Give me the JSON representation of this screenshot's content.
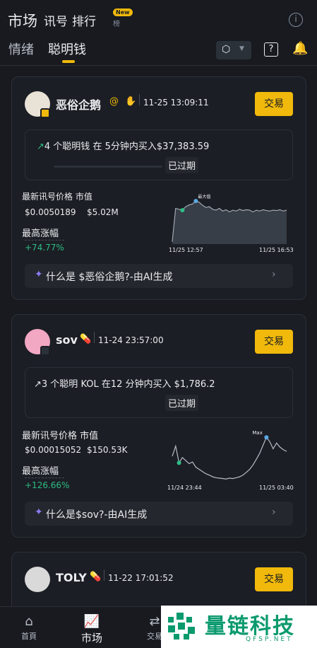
{
  "header": {
    "tab_market": "市场",
    "tab_signals": "讯号",
    "tab_rank": "排行",
    "new_badge": "New",
    "rank_sub": "榜",
    "info_icon": "info-icon"
  },
  "subtabs": {
    "sentiment": "情绪",
    "smart_money": "聪明钱",
    "active": "smart_money"
  },
  "colors": {
    "accent": "#f0b90b",
    "up": "#2ebd85",
    "bg": "#181a20",
    "card": "#1b1e24"
  },
  "cards": [
    {
      "name": "恶俗企鹅",
      "time": "11-25 13:09:11",
      "trade_label": "交易",
      "signal": "4 个聪明钱 在 5分钟内买入$37,383.59",
      "status": "已过期",
      "price_label": "最新讯号价格",
      "mcap_label": "市值",
      "price": "$0.0050189",
      "mcap": "$5.02M",
      "gain_label": "最高涨幅",
      "gain": "+74.77%",
      "max_label": "最大值",
      "x_start": "11/25 12:57",
      "x_end": "11/25 16:53",
      "ai_text": "什么是 $恶俗企鹅?-由AI生成",
      "spark": [
        0.02,
        0.78,
        0.76,
        0.74,
        0.82,
        0.86,
        0.88,
        0.95,
        0.92,
        0.85,
        0.8,
        0.82,
        0.76,
        0.74,
        0.78,
        0.72,
        0.75,
        0.7,
        0.74,
        0.72,
        0.76,
        0.73,
        0.75,
        0.74,
        0.7,
        0.74,
        0.72,
        0.75,
        0.73,
        0.72,
        0.74,
        0.73,
        0.75,
        0.72,
        0.74
      ]
    },
    {
      "name": "sov",
      "time": "11-24 23:57:00",
      "trade_label": "交易",
      "signal": "3 个聪明 KOL 在12 分钟内买入 $1,786.2",
      "status": "已过期",
      "price_label": "最新讯号价格",
      "mcap_label": "市值",
      "price": "$0.00015052",
      "mcap": "$150.53K",
      "gain_label": "最高涨幅",
      "gain": "+126.66%",
      "max_label": "Max",
      "x_start": "11/24 23:44",
      "x_end": "11/25 03:40",
      "ai_text": "什么是$sov?-由AI生成",
      "spark": [
        0.55,
        0.78,
        0.4,
        0.52,
        0.45,
        0.38,
        0.42,
        0.3,
        0.25,
        0.2,
        0.15,
        0.12,
        0.08,
        0.06,
        0.05,
        0.04,
        0.03,
        0.05,
        0.04,
        0.06,
        0.08,
        0.12,
        0.18,
        0.25,
        0.35,
        0.48,
        0.62,
        0.8,
        0.98,
        0.88,
        0.72,
        0.85,
        0.76,
        0.7,
        0.66
      ]
    },
    {
      "name": "TOLY",
      "time": "11-22 17:01:52",
      "trade_label": "交易"
    }
  ],
  "bottom_nav": {
    "home": "首頁",
    "market": "市场",
    "trade": "交易"
  },
  "watermark": {
    "text": "量链科技",
    "url": "QFSP.NET"
  }
}
